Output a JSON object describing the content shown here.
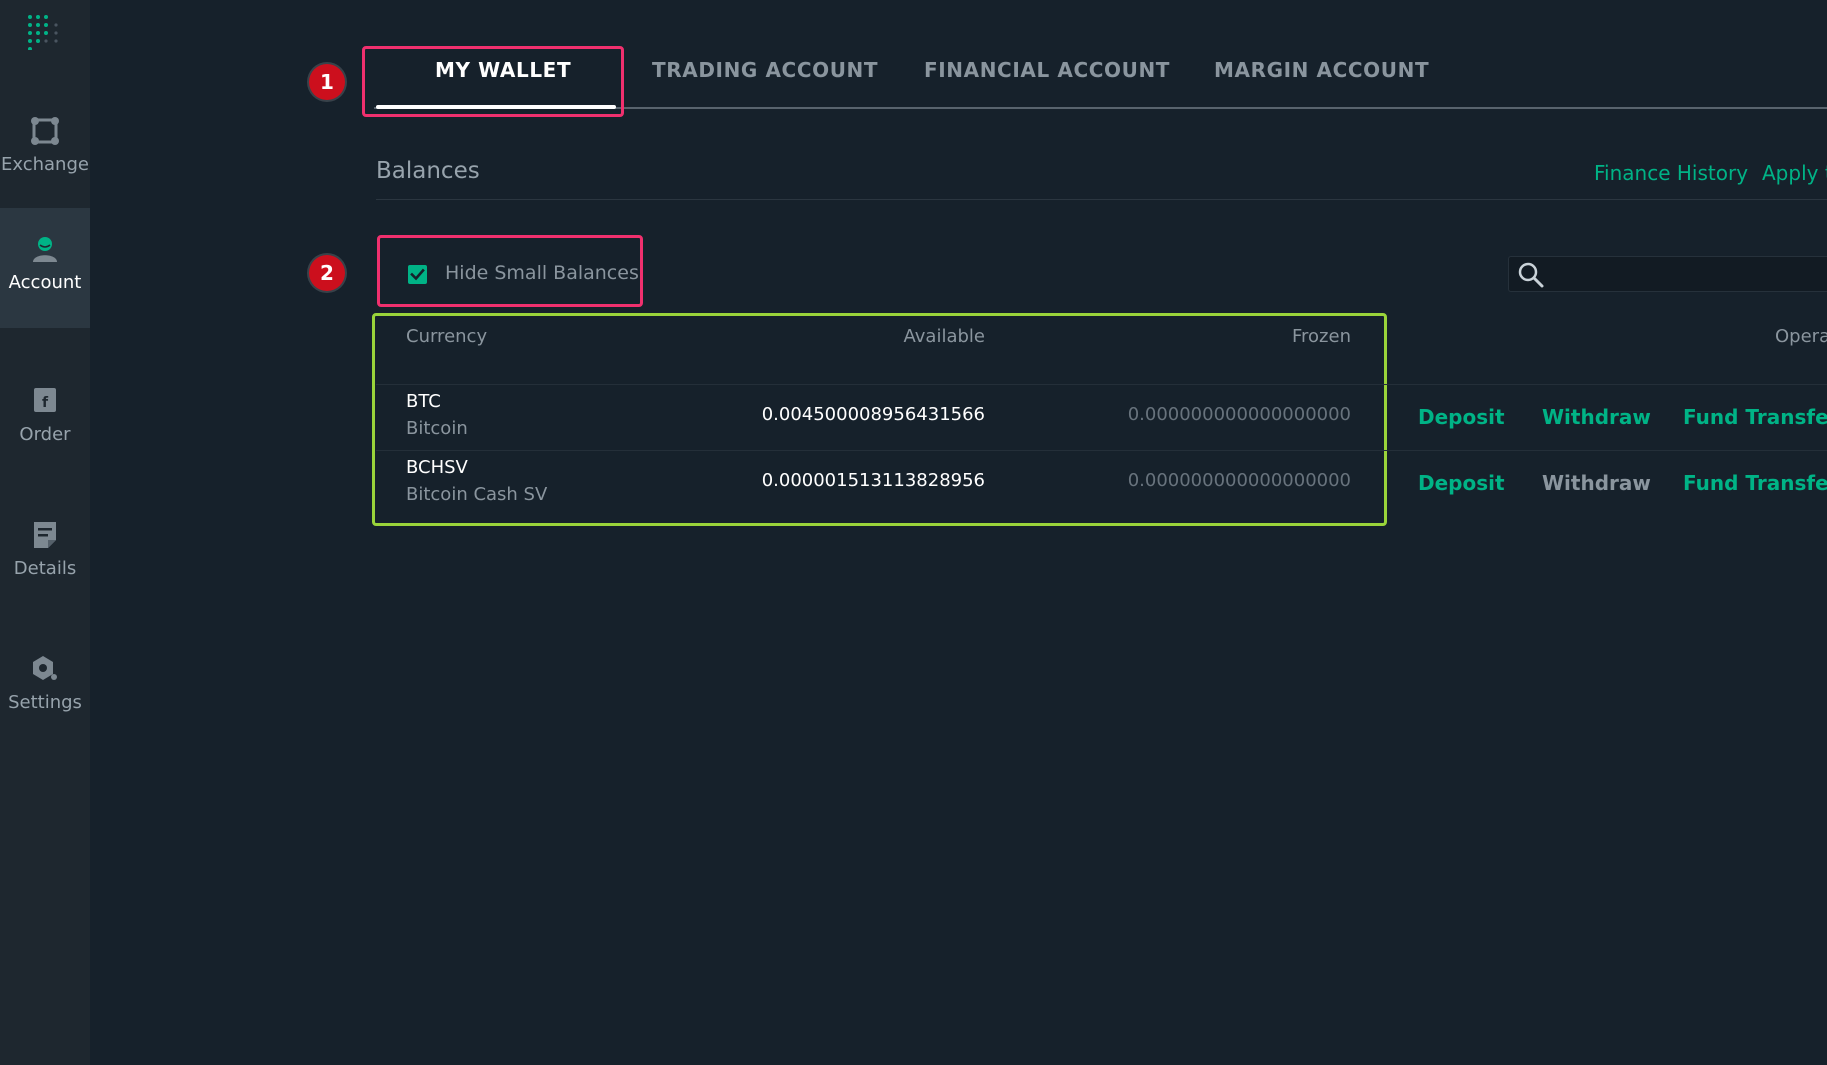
{
  "sidebar": {
    "logo_icon": "dot-grid-logo-icon",
    "items": [
      {
        "label": "Exchange",
        "icon": "exchange-icon"
      },
      {
        "label": "Account",
        "icon": "user-icon",
        "active": true
      },
      {
        "label": "Order",
        "icon": "order-icon"
      },
      {
        "label": "Details",
        "icon": "document-icon"
      },
      {
        "label": "Settings",
        "icon": "gear-icon"
      }
    ]
  },
  "tabs": [
    {
      "label": "MY WALLET",
      "active": true
    },
    {
      "label": "TRADING ACCOUNT"
    },
    {
      "label": "FINANCIAL ACCOUNT"
    },
    {
      "label": "MARGIN ACCOUNT"
    }
  ],
  "annotations": {
    "badge_1": "1",
    "badge_2": "2"
  },
  "balances": {
    "title": "Balances",
    "links": [
      "Finance History",
      "Apply to"
    ],
    "hide_small_label": "Hide Small Balances",
    "hide_small_checked": true,
    "search_placeholder": ""
  },
  "table": {
    "headers": {
      "currency": "Currency",
      "available": "Available",
      "frozen": "Frozen",
      "operation": "Opera"
    },
    "rows": [
      {
        "code": "BTC",
        "name": "Bitcoin",
        "available": "0.004500008956431566",
        "frozen": "0.000000000000000000",
        "actions": [
          "Deposit",
          "Withdraw",
          "Fund Transfer"
        ],
        "withdraw_enabled": true
      },
      {
        "code": "BCHSV",
        "name": "Bitcoin Cash SV",
        "available": "0.000001513113828956",
        "frozen": "0.000000000000000000",
        "actions": [
          "Deposit",
          "Withdraw",
          "Fund Transfer"
        ],
        "withdraw_enabled": false
      }
    ]
  },
  "colors": {
    "accent": "#00b386",
    "background": "#16212b",
    "sidebar": "#1e272f",
    "annotation_pink": "#f0306e",
    "annotation_green": "#9ad43a",
    "badge_red": "#cc0f1d"
  }
}
